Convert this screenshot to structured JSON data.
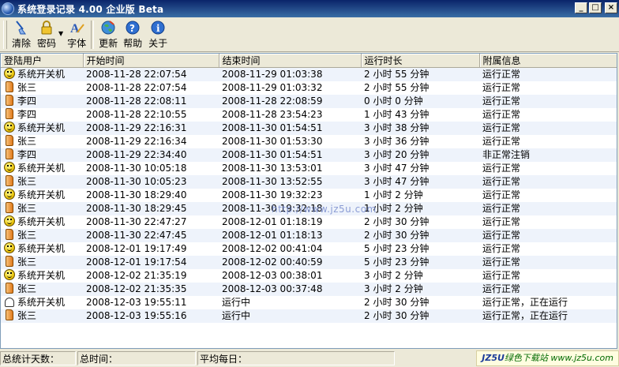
{
  "window": {
    "title": "系统登录记录 4.00 企业版 Beta",
    "buttons": [
      "_",
      "□",
      "×"
    ]
  },
  "toolbar": {
    "items": [
      {
        "label": "清除",
        "icon": "broom-icon"
      },
      {
        "label": "密码",
        "icon": "lock-icon"
      },
      {
        "label": "字体",
        "icon": "font-icon"
      },
      {
        "label": "更新",
        "icon": "update-globe-icon"
      },
      {
        "label": "帮助",
        "icon": "help-icon"
      },
      {
        "label": "关于",
        "icon": "info-icon"
      }
    ]
  },
  "list": {
    "columns": [
      "登陆用户",
      "开始时间",
      "结束时间",
      "运行时长",
      "附属信息"
    ],
    "rows": [
      {
        "icon": "smiley-icon",
        "user": "系统开关机",
        "start": "2008-11-28 22:07:54",
        "end": "2008-11-29 01:03:38",
        "duration": "2 小时 55 分钟",
        "info": "运行正常"
      },
      {
        "icon": "document-icon",
        "user": "张三",
        "start": "2008-11-28 22:07:54",
        "end": "2008-11-29 01:03:32",
        "duration": "2 小时 55 分钟",
        "info": "运行正常"
      },
      {
        "icon": "document-icon",
        "user": "李四",
        "start": "2008-11-28 22:08:11",
        "end": "2008-11-28 22:08:59",
        "duration": "0 小时  0 分钟",
        "info": "运行正常"
      },
      {
        "icon": "document-icon",
        "user": "李四",
        "start": "2008-11-28 22:10:55",
        "end": "2008-11-28 23:54:23",
        "duration": "1 小时 43 分钟",
        "info": "运行正常"
      },
      {
        "icon": "smiley-icon",
        "user": "系统开关机",
        "start": "2008-11-29 22:16:31",
        "end": "2008-11-30 01:54:51",
        "duration": "3 小时 38 分钟",
        "info": "运行正常"
      },
      {
        "icon": "document-icon",
        "user": "张三",
        "start": "2008-11-29 22:16:34",
        "end": "2008-11-30 01:53:30",
        "duration": "3 小时 36 分钟",
        "info": "运行正常"
      },
      {
        "icon": "document-icon",
        "user": "李四",
        "start": "2008-11-29 22:34:40",
        "end": "2008-11-30 01:54:51",
        "duration": "3 小时 20 分钟",
        "info": "非正常注销"
      },
      {
        "icon": "smiley-icon",
        "user": "系统开关机",
        "start": "2008-11-30 10:05:18",
        "end": "2008-11-30 13:53:01",
        "duration": "3 小时 47 分钟",
        "info": "运行正常"
      },
      {
        "icon": "document-icon",
        "user": "张三",
        "start": "2008-11-30 10:05:23",
        "end": "2008-11-30 13:52:55",
        "duration": "3 小时 47 分钟",
        "info": "运行正常"
      },
      {
        "icon": "smiley-icon",
        "user": "系统开关机",
        "start": "2008-11-30 18:29:40",
        "end": "2008-11-30 19:32:23",
        "duration": "1 小时  2 分钟",
        "info": "运行正常"
      },
      {
        "icon": "document-icon",
        "user": "张三",
        "start": "2008-11-30 18:29:45",
        "end": "2008-11-30 19:32:18",
        "duration": "1 小时  2 分钟",
        "info": "运行正常"
      },
      {
        "icon": "smiley-icon",
        "user": "系统开关机",
        "start": "2008-11-30 22:47:27",
        "end": "2008-12-01 01:18:19",
        "duration": "2 小时 30 分钟",
        "info": "运行正常"
      },
      {
        "icon": "document-icon",
        "user": "张三",
        "start": "2008-11-30 22:47:45",
        "end": "2008-12-01 01:18:13",
        "duration": "2 小时 30 分钟",
        "info": "运行正常"
      },
      {
        "icon": "smiley-icon",
        "user": "系统开关机",
        "start": "2008-12-01 19:17:49",
        "end": "2008-12-02 00:41:04",
        "duration": "5 小时 23 分钟",
        "info": "运行正常"
      },
      {
        "icon": "document-icon",
        "user": "张三",
        "start": "2008-12-01 19:17:54",
        "end": "2008-12-02 00:40:59",
        "duration": "5 小时 23 分钟",
        "info": "运行正常"
      },
      {
        "icon": "smiley-icon",
        "user": "系统开关机",
        "start": "2008-12-02 21:35:19",
        "end": "2008-12-03 00:38:01",
        "duration": "3 小时  2 分钟",
        "info": "运行正常"
      },
      {
        "icon": "document-icon",
        "user": "张三",
        "start": "2008-12-02 21:35:35",
        "end": "2008-12-03 00:37:48",
        "duration": "3 小时  2 分钟",
        "info": "运行正常"
      },
      {
        "icon": "bell-icon",
        "user": "系统开关机",
        "start": "2008-12-03 19:55:11",
        "end": "运行中",
        "duration": "2 小时 30 分钟",
        "info": "运行正常，正在运行"
      },
      {
        "icon": "document-icon",
        "user": "张三",
        "start": "2008-12-03 19:55:16",
        "end": "运行中",
        "duration": "2 小时 30 分钟",
        "info": "运行正常，正在运行"
      }
    ]
  },
  "watermark": "http://www.jz5u.com",
  "statusbar": {
    "total_days": "总统计天数：",
    "total_time": "总时间：",
    "daily_avg": "平均每日：",
    "logo_prefix": "JZ5U",
    "logo_text": "绿色下载站",
    "logo_url": "www.jz5u.com"
  }
}
